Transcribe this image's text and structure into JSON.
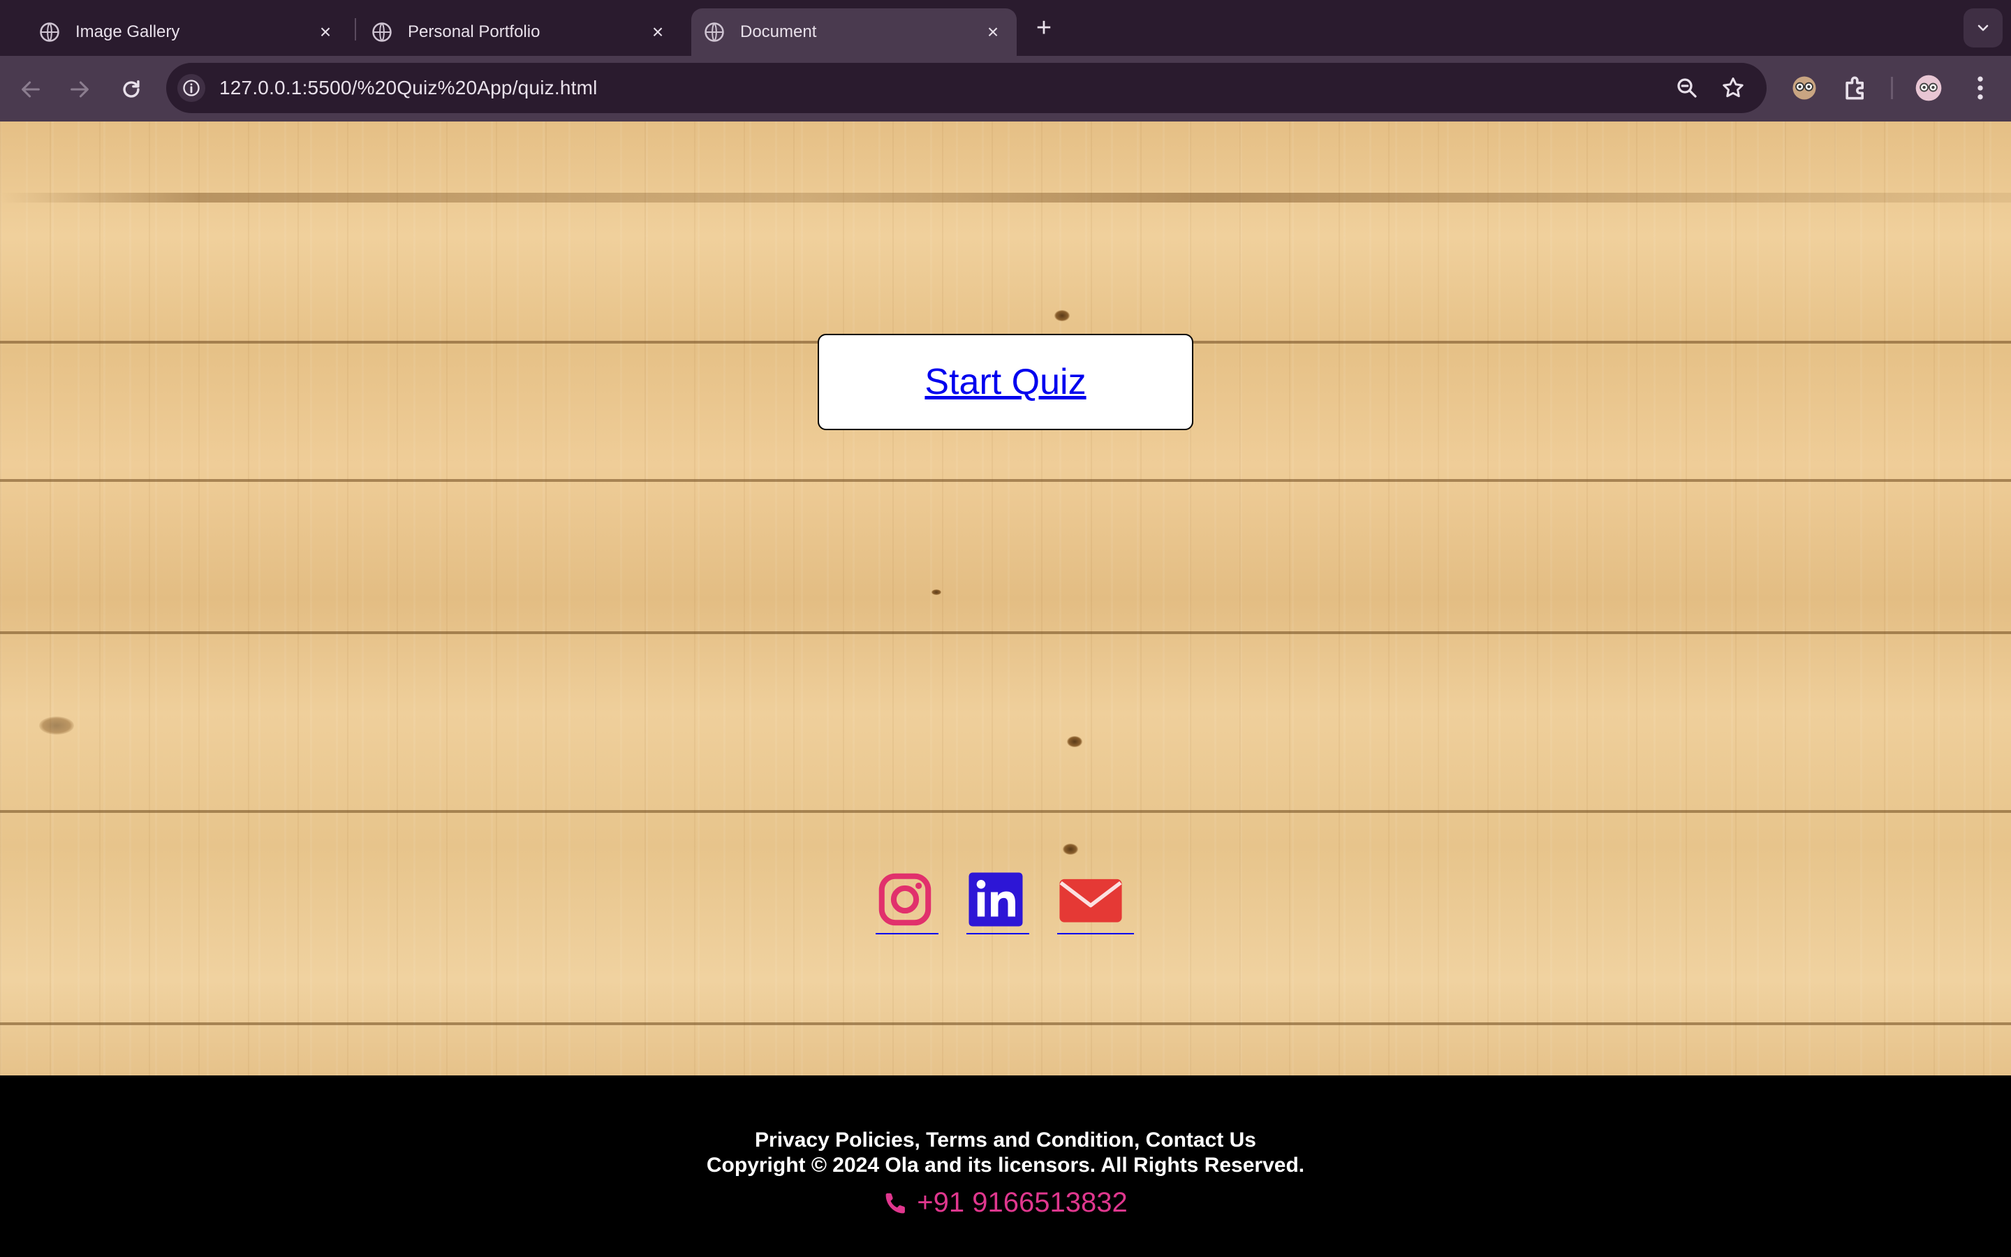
{
  "browser": {
    "tabs": [
      {
        "title": "Image Gallery",
        "active": false
      },
      {
        "title": "Personal Portfolio",
        "active": false
      },
      {
        "title": "Document",
        "active": true
      }
    ],
    "url": "127.0.0.1:5500/%20Quiz%20App/quiz.html",
    "icons": [
      "back-icon",
      "forward-icon",
      "reload-icon",
      "site-info-icon",
      "zoom-icon",
      "bookmark-star-icon",
      "extension-avatar-icon",
      "extensions-puzzle-icon",
      "profile-avatar-icon",
      "menu-kebab-icon"
    ]
  },
  "page": {
    "start_quiz_label": "Start Quiz",
    "socials": [
      {
        "name": "instagram",
        "color": "#e1306c"
      },
      {
        "name": "linkedin",
        "color": "#2d16d6"
      },
      {
        "name": "email",
        "color": "#e53935"
      }
    ]
  },
  "footer": {
    "links": "Privacy Policies, Terms and Condition, Contact Us",
    "copyright": "Copyright © 2024 Ola and its licensors. All Rights Reserved.",
    "phone": "+91 9166513832",
    "phone_color": "#e0378e"
  }
}
